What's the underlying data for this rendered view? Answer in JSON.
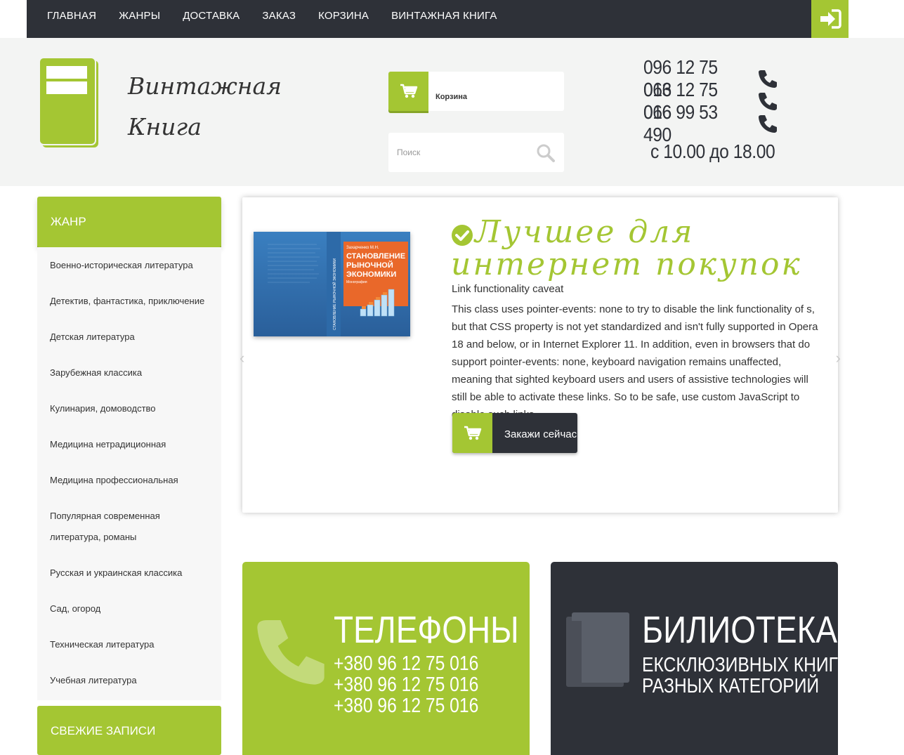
{
  "nav": {
    "items": [
      "ГЛАВНАЯ",
      "ЖАНРЫ",
      "ДОСТАВКА",
      "ЗАКАЗ",
      "КОРЗИНА",
      "ВИНТАЖНАЯ КНИГА"
    ],
    "login_icon": "sign-in-icon"
  },
  "header": {
    "logo_line1": "Винтажная",
    "logo_line2": "Книга",
    "cart_label": "Корзина",
    "search_placeholder": "Поиск",
    "phones": [
      "096 12 75 016",
      "063 12 75 016",
      "066 99 53 490"
    ],
    "hours": "с 10.00 до 18.00"
  },
  "sidebar": {
    "genre_title": "ЖАНР",
    "genres": [
      "Военно-историческая литература",
      "Детектив, фантастика, приключение",
      "Детская литература",
      "Зарубежная классика",
      "Кулинария, домоводство",
      "Медицина нетрадиционная",
      "Медицина профессиональная",
      "Популярная современная литература, романы",
      "Русская и украинская классика",
      "Сад, огород",
      "Техническая литература",
      "Учебная литература"
    ],
    "fresh_title": "СВЕЖИЕ ЗАПИСИ"
  },
  "slider": {
    "title_line1": "Лучшее для",
    "title_line2": "интернет покупок",
    "subtitle": "Link functionality caveat",
    "text": "This class uses pointer-events: none to try to disable the link functionality of s, but that CSS property is not yet standardized and isn't fully supported in Opera 18 and below, or in Internet Explorer 11. In addition, even in browsers that do support pointer-events: none, keyboard navigation remains unaffected, meaning that sighted keyboard users and users of assistive technologies will still be able to activate these links. So to be safe, use custom JavaScript to disable such links.",
    "order_button": "Закажи сейчас",
    "book_author": "Захарченко М.Н.",
    "book_title": "СТАНОВЛЕНИЕ РЫНОЧНОЙ ЭКОНОМИКИ",
    "book_subtitle": "Монография"
  },
  "phones_box": {
    "title": "ТЕЛЕФОНЫ",
    "numbers": [
      "+380 96 12 75 016",
      "+380 96 12 75 016",
      "+380 96 12 75 016"
    ]
  },
  "library_box": {
    "title": "БИЛИОТЕКА",
    "line1": "ЕКСКЛЮЗИВНЫХ КНИГ",
    "line2": "РАЗНЫХ КАТЕГОРИЙ"
  },
  "colors": {
    "accent": "#a4c633",
    "dark": "#2e3138",
    "header_bg": "#f3f4f3"
  }
}
